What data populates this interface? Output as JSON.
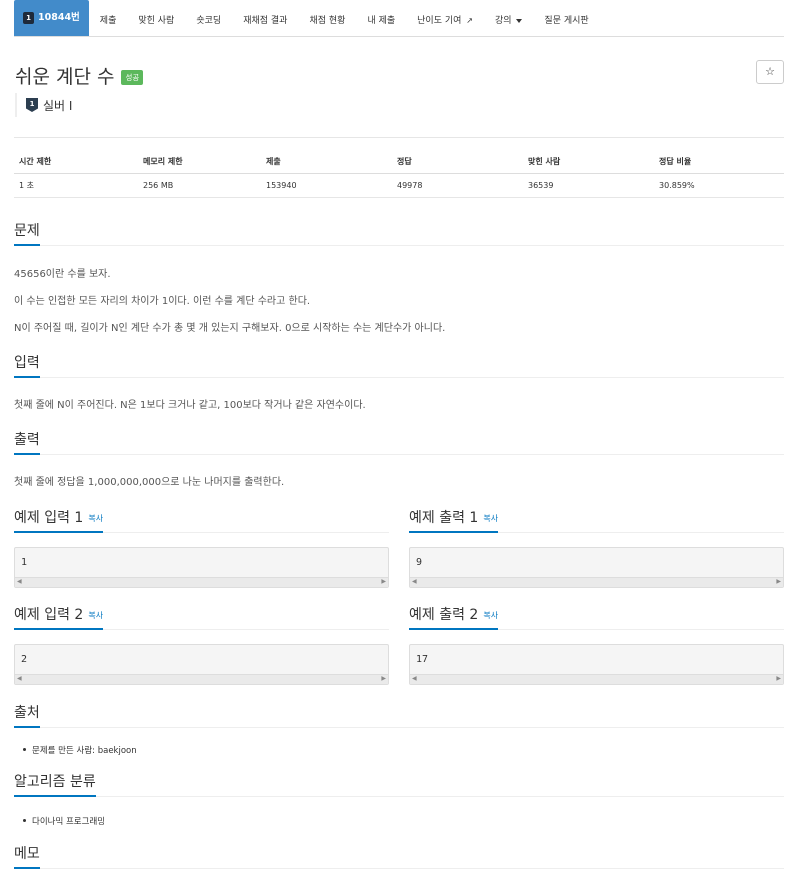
{
  "nav": {
    "active_label": "10844번",
    "active_tier_num": "1",
    "tabs": [
      "제출",
      "맞힌 사람",
      "숏코딩",
      "재채점 결과",
      "채점 현황",
      "내 제출"
    ],
    "difficulty_label": "난이도 기여",
    "lecture_label": "강의",
    "board_label": "질문 게시판"
  },
  "problem": {
    "title": "쉬운 계단 수",
    "status_label": "성공",
    "star_glyph": "☆",
    "tier_num": "1",
    "tier_label": "실버 I"
  },
  "stats": {
    "headers": [
      "시간 제한",
      "메모리 제한",
      "제출",
      "정답",
      "맞힌 사람",
      "정답 비율"
    ],
    "values": [
      "1 초",
      "256 MB",
      "153940",
      "49978",
      "36539",
      "30.859%"
    ]
  },
  "sections": {
    "problem_title": "문제",
    "problem_lines": [
      "45656이란 수를 보자.",
      "이 수는 인접한 모든 자리의 차이가 1이다. 이런 수를 계단 수라고 한다.",
      "N이 주어질 때, 길이가 N인 계단 수가 총 몇 개 있는지 구해보자. 0으로 시작하는 수는 계단수가 아니다."
    ],
    "input_title": "입력",
    "input_text": "첫째 줄에 N이 주어진다. N은 1보다 크거나 같고, 100보다 작거나 같은 자연수이다.",
    "output_title": "출력",
    "output_text": "첫째 줄에 정답을 1,000,000,000으로 나눈 나머지를 출력한다.",
    "source_title": "출처",
    "source_item": "문제를 만든 사람: baekjoon",
    "algo_title": "알고리즘 분류",
    "algo_item": "다이나믹 프로그래밍",
    "memo_title": "메모"
  },
  "samples": {
    "copy_label": "복사",
    "in1_title": "예제 입력 1",
    "out1_title": "예제 출력 1",
    "in2_title": "예제 입력 2",
    "out2_title": "예제 출력 2",
    "in1_value": "1",
    "out1_value": "9",
    "in2_value": "2",
    "out2_value": "17"
  }
}
